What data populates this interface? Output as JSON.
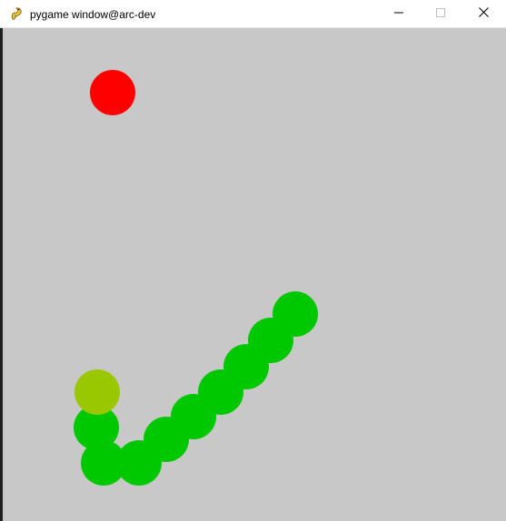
{
  "window": {
    "title": "pygame window@arc-dev",
    "icon": "pygame-snake-icon",
    "controls": {
      "minimize_icon": "minimize-icon",
      "maximize_icon": "maximize-icon",
      "close_icon": "close-icon"
    }
  },
  "game": {
    "background_color": "#c8c8c8",
    "food": {
      "color": "#ff0000",
      "icon": "apple-food"
    },
    "snake": {
      "head_color": "#99c800",
      "body_color": "#00c800",
      "length": 10
    }
  }
}
